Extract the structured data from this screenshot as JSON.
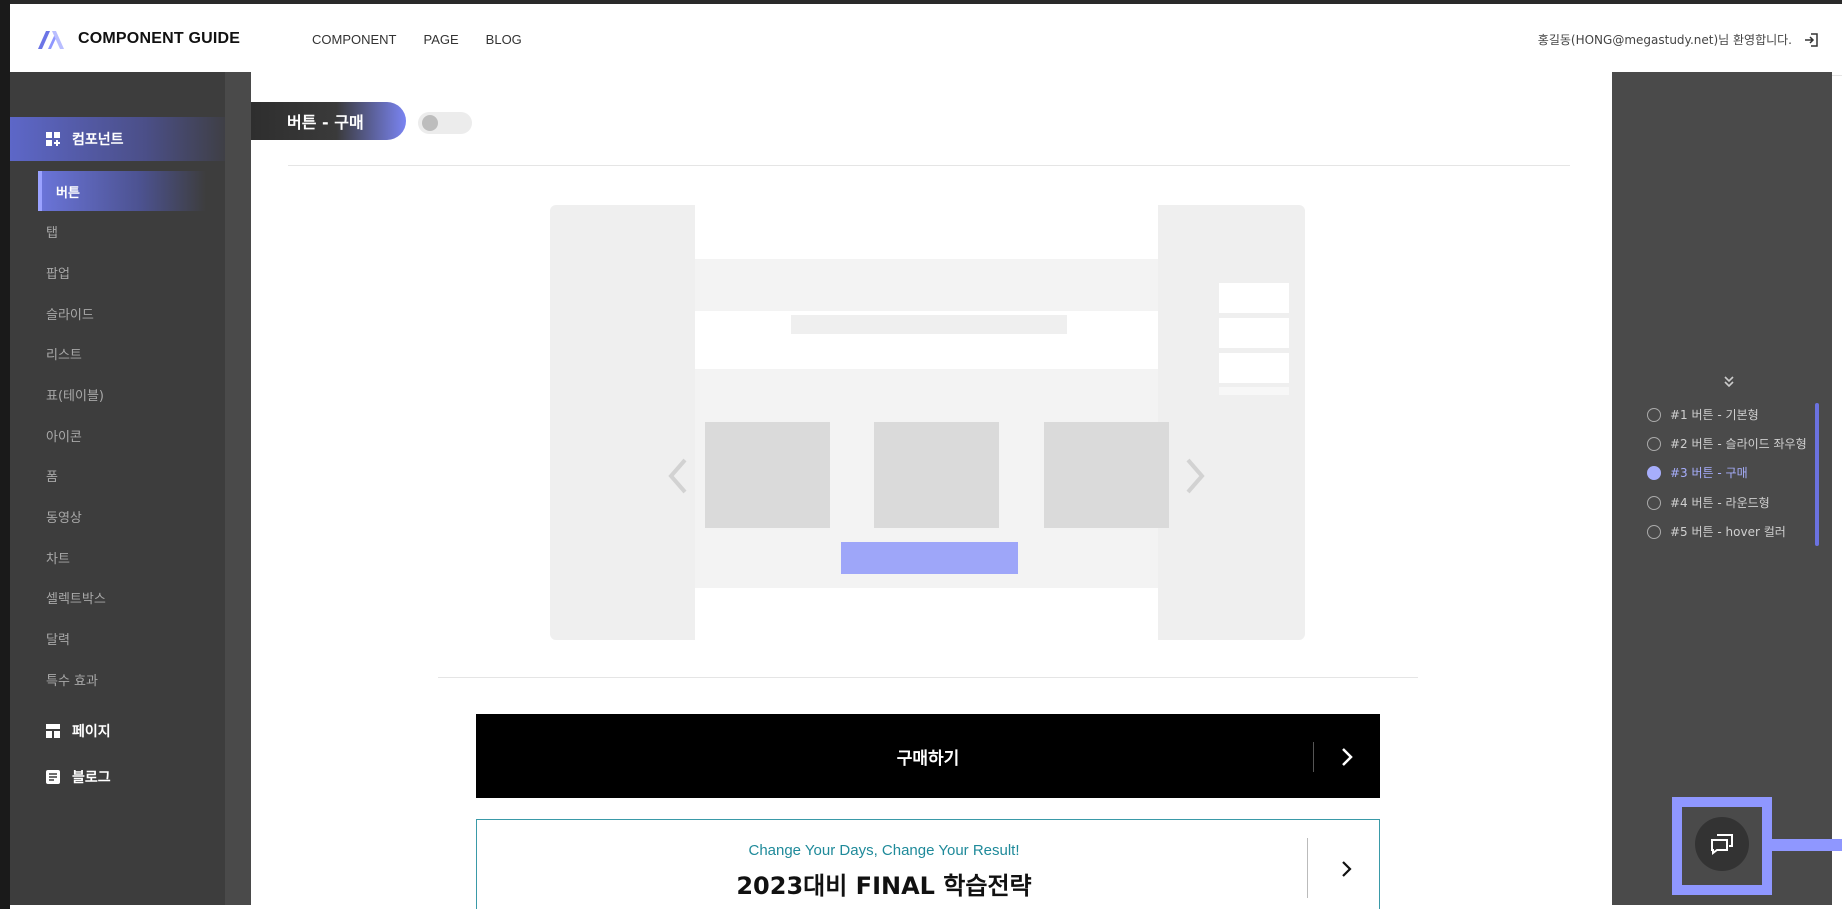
{
  "header": {
    "logo_text": "COMPONENT GUIDE",
    "nav": [
      "COMPONENT",
      "PAGE",
      "BLOG"
    ],
    "welcome": "홍길동(HONG@megastudy.net)님 환영합니다."
  },
  "sidebar": {
    "categories": [
      {
        "label": "컴포넌트",
        "icon": "grid-icon"
      },
      {
        "label": "페이지",
        "icon": "layout-icon"
      },
      {
        "label": "블로그",
        "icon": "document-icon"
      }
    ],
    "items": [
      "버튼",
      "탭",
      "팝업",
      "슬라이드",
      "리스트",
      "표(테이블)",
      "아이콘",
      "폼",
      "동영상",
      "차트",
      "셀렉트박스",
      "달력",
      "특수 효과"
    ]
  },
  "section": {
    "title": "버튼 - 구매"
  },
  "buttons": {
    "buy_label": "구매하기",
    "promo_sub": "Change Your Days, Change Your Result!",
    "promo_title": "2023대비 FINAL 학습전략"
  },
  "toc": {
    "items": [
      "#1 버튼 - 기본형",
      "#2 버튼 - 슬라이드 좌우형",
      "#3 버튼 - 구매",
      "#4 버튼 - 라운드형",
      "#5 버튼 - hover 컬러"
    ],
    "active_index": 2
  },
  "colors": {
    "accent": "#8f97ff",
    "sidebar_bg": "#3d3d3d",
    "promo_border": "#3a9aa8"
  }
}
